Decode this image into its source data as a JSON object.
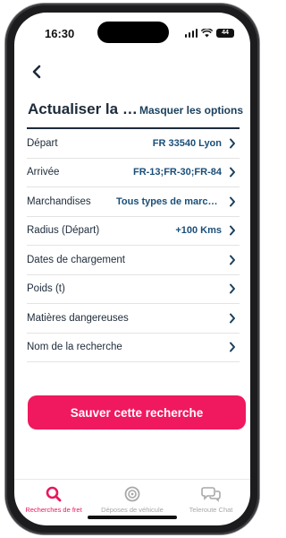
{
  "status_bar": {
    "time": "16:30",
    "battery": "44"
  },
  "header": {
    "title": "Actualiser la recherche",
    "options_link": "Masquer les options"
  },
  "filters": [
    {
      "label": "Départ",
      "value": "FR 33540 Lyon"
    },
    {
      "label": "Arrivée",
      "value": "FR-13;FR-30;FR-84"
    },
    {
      "label": "Marchandises",
      "value": "Tous types de marchandises"
    },
    {
      "label": "Radius (Départ)",
      "value": "+100 Kms"
    },
    {
      "label": "Dates de chargement",
      "value": ""
    },
    {
      "label": "Poids (t)",
      "value": ""
    },
    {
      "label": "Matières dangereuses",
      "value": ""
    },
    {
      "label": "Nom de la recherche",
      "value": ""
    }
  ],
  "save_button": "Sauver cette recherche",
  "tabs": [
    {
      "label": "Recherches de fret",
      "icon": "search-icon",
      "active": true
    },
    {
      "label": "Déposes de véhicule",
      "icon": "target-icon",
      "active": false
    },
    {
      "label": "Teleroute Chat",
      "icon": "chat-icon",
      "active": false
    }
  ],
  "colors": {
    "accent": "#f0185f",
    "navy": "#1d2b3a",
    "value_blue": "#1a4e78",
    "active_tab": "#e8175d"
  }
}
